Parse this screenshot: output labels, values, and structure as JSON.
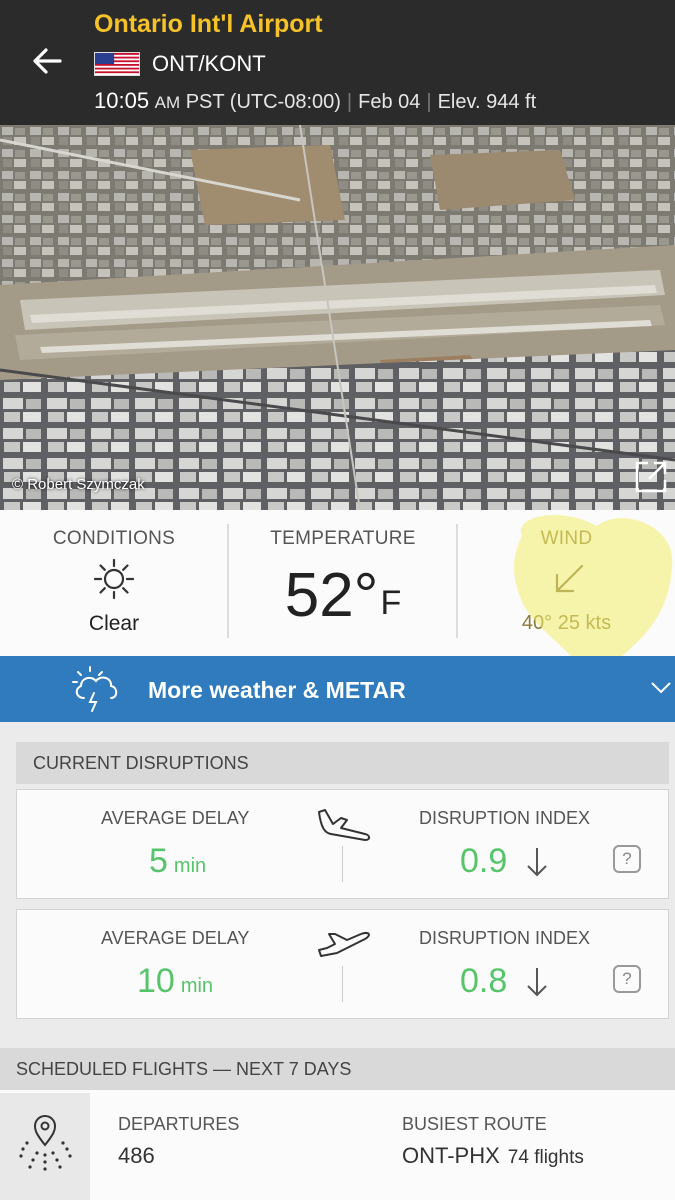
{
  "header": {
    "back_icon": "arrow-left-icon",
    "airport_name": "Ontario Int'l Airport",
    "flag_icon": "us-flag-icon",
    "codes": "ONT/KONT",
    "time": "10:05",
    "ampm": "AM",
    "timezone": "PST (UTC-08:00)",
    "date": "Feb 04",
    "elevation": "Elev. 944 ft",
    "title_color": "#f6c22a"
  },
  "photo": {
    "credit": "© Robert Szymczak",
    "expand_icon": "expand-icon"
  },
  "weather": {
    "conditions_label": "CONDITIONS",
    "conditions_icon": "sun-icon",
    "conditions_value": "Clear",
    "temperature_label": "TEMPERATURE",
    "temperature_value": "52°",
    "temperature_unit": "F",
    "wind_label": "WIND",
    "wind_icon": "arrow-down-left-icon",
    "wind_value": "40° 25 kts"
  },
  "weather_bar": {
    "icon": "storm-cloud-icon",
    "label": "More weather & METAR",
    "chevron": "chevron-down-icon",
    "color": "#2f7bbd"
  },
  "disruptions": {
    "title": "CURRENT DISRUPTIONS",
    "rows": [
      {
        "type": "arrivals",
        "plane_icon": "plane-landing-icon",
        "delay_label": "AVERAGE DELAY",
        "delay_value": "5",
        "delay_unit": "min",
        "index_label": "DISRUPTION INDEX",
        "index_value": "0.9",
        "trend_icon": "arrow-down-icon",
        "help": "?"
      },
      {
        "type": "departures",
        "plane_icon": "plane-takeoff-icon",
        "delay_label": "AVERAGE DELAY",
        "delay_value": "10",
        "delay_unit": "min",
        "index_label": "DISRUPTION INDEX",
        "index_value": "0.8",
        "trend_icon": "arrow-down-icon",
        "help": "?"
      }
    ],
    "value_color": "#56c46a"
  },
  "scheduled": {
    "title": "SCHEDULED FLIGHTS — NEXT 7 DAYS",
    "icon": "route-map-pin-icon",
    "departures_label": "DEPARTURES",
    "departures_value": "486",
    "busiest_label": "BUSIEST ROUTE",
    "busiest_route": "ONT-PHX",
    "busiest_count": "74 flights"
  }
}
